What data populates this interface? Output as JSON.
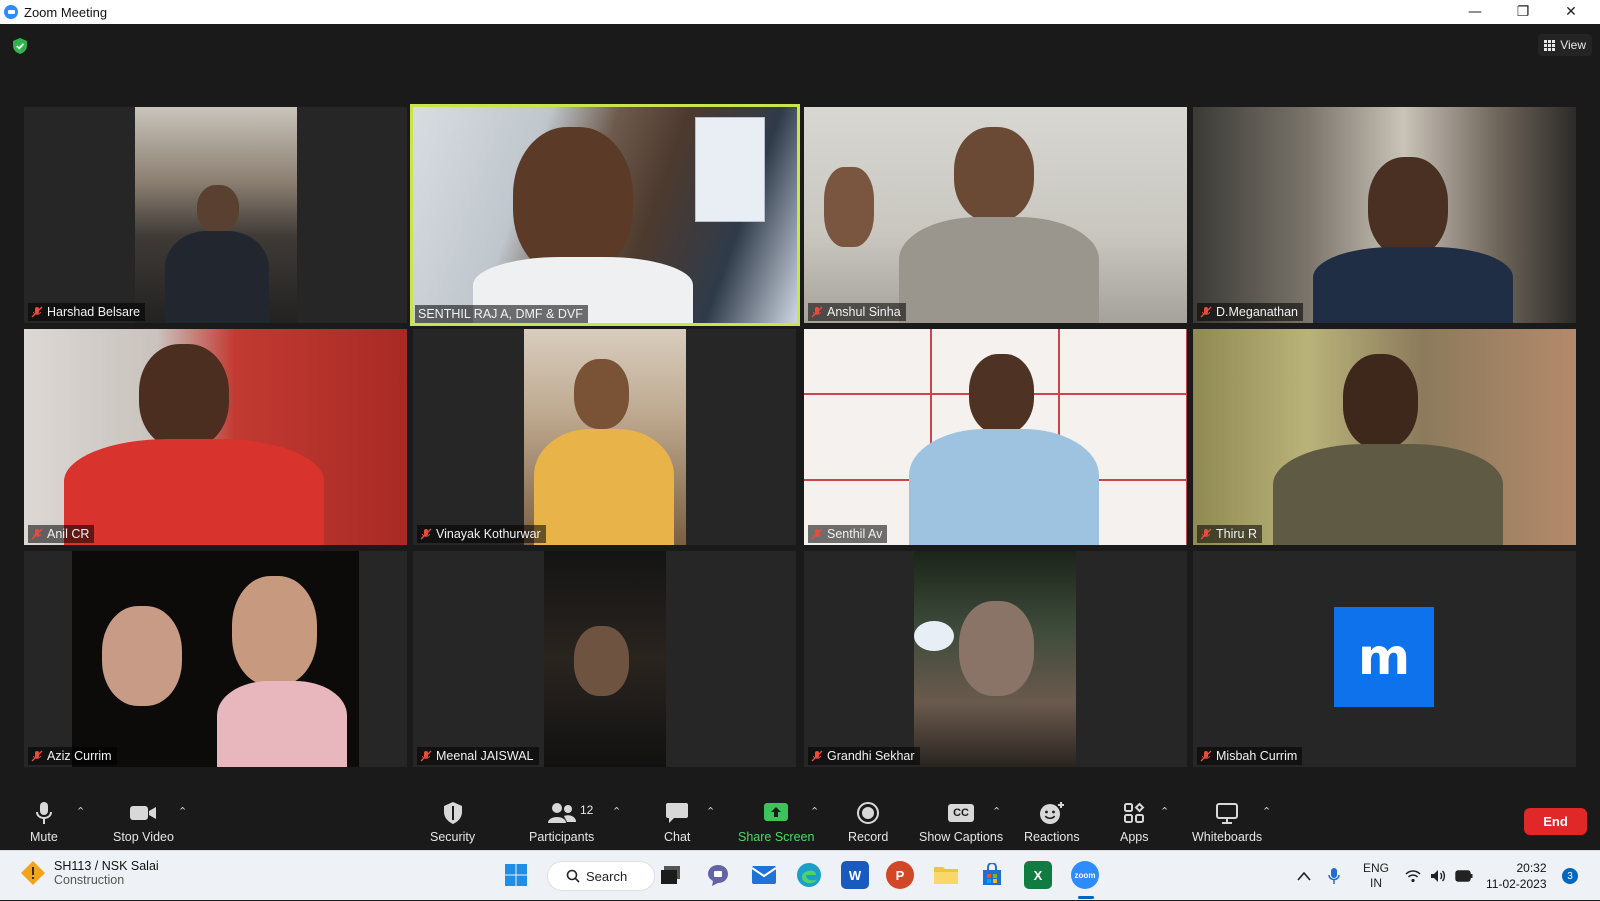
{
  "window": {
    "title": "Zoom Meeting",
    "minimize_glyph": "—",
    "restore_glyph": "❐",
    "close_glyph": "✕"
  },
  "meeting": {
    "view_label": "View",
    "security_indicator": "shield-check-icon",
    "participants": [
      {
        "name": "Harshad Belsare",
        "muted": true
      },
      {
        "name": "SENTHIL RAJ A, DMF & DVF",
        "muted": false,
        "active_speaker": true
      },
      {
        "name": "Anshul Sinha",
        "muted": true
      },
      {
        "name": "D.Meganathan",
        "muted": true
      },
      {
        "name": "Anil CR",
        "muted": true
      },
      {
        "name": "Vinayak Kothurwar",
        "muted": true
      },
      {
        "name": "Senthil Av",
        "muted": true
      },
      {
        "name": "Thiru R",
        "muted": true
      },
      {
        "name": "Aziz Currim",
        "muted": true
      },
      {
        "name": "Meenal JAISWAL",
        "muted": true
      },
      {
        "name": "Grandhi Sekhar",
        "muted": true
      },
      {
        "name": "Misbah Currim",
        "muted": true,
        "avatar_letter": "m"
      }
    ]
  },
  "toolbar": {
    "mute": "Mute",
    "stop_video": "Stop Video",
    "security": "Security",
    "participants": "Participants",
    "participants_count": "12",
    "chat": "Chat",
    "share_screen": "Share Screen",
    "record": "Record",
    "show_captions": "Show Captions",
    "reactions": "Reactions",
    "apps": "Apps",
    "whiteboards": "Whiteboards",
    "end": "End",
    "caret": "⌃",
    "captions_icon_text": "CC"
  },
  "taskbar": {
    "weather_title": "SH113 / NSK Salai",
    "weather_sub": "Construction",
    "search": "Search",
    "lang_top": "ENG",
    "lang_bottom": "IN",
    "time": "20:32",
    "date": "11-02-2023",
    "notifications": "3",
    "word_letter": "W",
    "powerpoint_letter": "P",
    "excel_letter": "X",
    "zoom_label": "zoom",
    "accent": "#0067c0"
  }
}
